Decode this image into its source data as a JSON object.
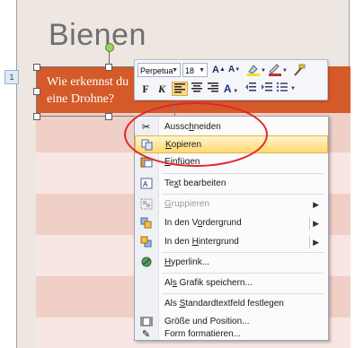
{
  "slide": {
    "title": "Bienen",
    "slide_number": "1"
  },
  "table": {
    "header_text": "Wie erkennst du eine Drohne?",
    "header_color": "#d45a2a",
    "row_colors": [
      "#f0cfc6",
      "#f8e6e2"
    ]
  },
  "mini_toolbar": {
    "font_name": "Perpetua",
    "font_size": "18",
    "grow_font_icon": "grow-font-icon",
    "shrink_font_icon": "shrink-font-icon",
    "bold_label": "F",
    "italic_label": "K"
  },
  "context_menu": {
    "items": [
      {
        "label": "Ausschneiden",
        "icon": "scissors-icon",
        "u": "h"
      },
      {
        "label": "Kopieren",
        "icon": "copy-icon",
        "highlighted": true
      },
      {
        "label": "Einfügen",
        "icon": "paste-icon"
      },
      {
        "label": "Text bearbeiten",
        "icon": "text-edit-icon"
      },
      {
        "label": "Gruppieren",
        "icon": "group-icon",
        "disabled": true,
        "submenu": true
      },
      {
        "label": "In den Vordergrund",
        "icon": "bring-front-icon",
        "submenu": true
      },
      {
        "label": "In den Hintergrund",
        "icon": "send-back-icon",
        "submenu": true
      },
      {
        "label": "Hyperlink...",
        "icon": "hyperlink-icon"
      },
      {
        "label": "Als Grafik speichern...",
        "icon": ""
      },
      {
        "label": "Als Standardtextfeld festlegen",
        "icon": ""
      },
      {
        "label": "Größe und Position...",
        "icon": "size-position-icon"
      },
      {
        "label": "Form formatieren...",
        "icon": "format-shape-icon"
      }
    ]
  },
  "annotation": {
    "ellipse_color": "#e0262a"
  }
}
